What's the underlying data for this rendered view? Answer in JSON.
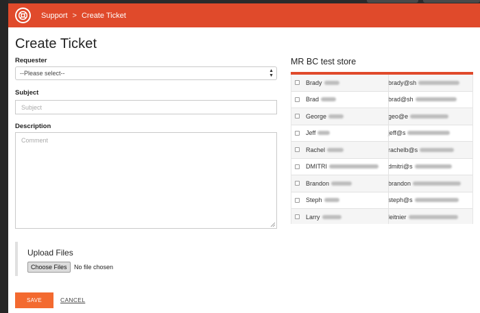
{
  "header": {
    "breadcrumb_root": "Support",
    "breadcrumb_current": "Create Ticket",
    "separator": ">",
    "accent_color": "#e04a2b"
  },
  "form": {
    "title": "Create Ticket",
    "requester_label": "Requester",
    "requester_value": "--Please select--",
    "subject_label": "Subject",
    "subject_placeholder": "Subject",
    "description_label": "Description",
    "description_placeholder": "Comment"
  },
  "upload": {
    "title": "Upload Files",
    "button_label": "Choose Files",
    "status": "No file chosen"
  },
  "actions": {
    "save_label": "SAVE",
    "cancel_label": "CANCEL",
    "save_color": "#f36a30"
  },
  "store": {
    "title": "MR BC test store",
    "rows": [
      {
        "name": "Brady",
        "email": "brady@sh"
      },
      {
        "name": "Brad",
        "email": "brad@sh"
      },
      {
        "name": "George",
        "email": "geo@e"
      },
      {
        "name": "Jeff",
        "email": "jeff@s"
      },
      {
        "name": "Rachel",
        "email": "rachelb@s"
      },
      {
        "name": "DMITRI",
        "email": "dmitri@s"
      },
      {
        "name": "Brandon",
        "email": "brandon"
      },
      {
        "name": "Steph",
        "email": "steph@s"
      },
      {
        "name": "Larry",
        "email": "leitnier"
      }
    ]
  }
}
